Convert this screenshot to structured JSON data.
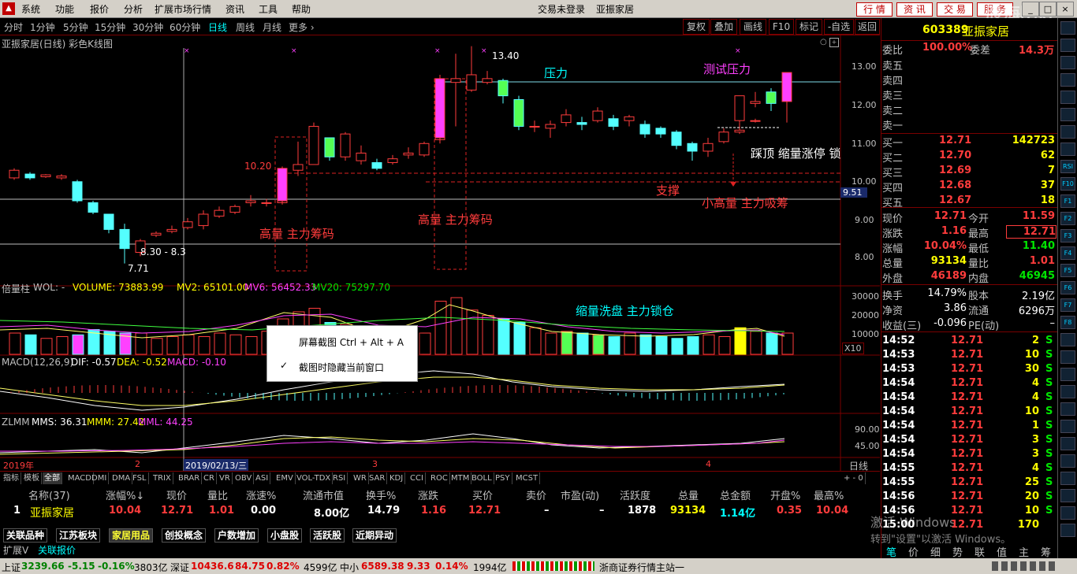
{
  "menu": {
    "items": [
      "系统",
      "功能",
      "报价",
      "分析",
      "扩展市场行情",
      "资讯",
      "工具",
      "帮助"
    ],
    "center": [
      "交易未登录",
      "亚振家居"
    ],
    "buttons": [
      "行 情",
      "资 讯",
      "交 易",
      "服 务"
    ],
    "watermark": "股海明灯"
  },
  "toolbar": {
    "periods": [
      "分时",
      "1分钟",
      "5分钟",
      "15分钟",
      "30分钟",
      "60分钟",
      "日线",
      "周线",
      "月线",
      "更多 ›"
    ],
    "active_period": "日线",
    "buttons": [
      "复权",
      "叠加",
      "画线",
      "F10",
      "标记",
      "-自选",
      "返回"
    ]
  },
  "chart": {
    "title": "亚振家居(日线) 彩色K线图",
    "price_axis": [
      "13.00",
      "12.00",
      "11.00",
      "10.00",
      "9.00",
      "8.00"
    ],
    "current_price_tag": "9.51",
    "annotations": {
      "high_label": "13.40",
      "level_1020": "10.20",
      "low_range": "8.30 - 8.3",
      "low_label": "7.71",
      "pressure": "压力",
      "test_pressure": "测试压力",
      "kick_top": "踩顶 缩量涨停 锁",
      "support": "支撑",
      "small_volume": "小高量 主力吸筹",
      "high_volume_1": "高量 主力筹码",
      "high_volume_2": "高量 主力筹码",
      "shrink_wash": "缩量洗盘 主力锁仓"
    },
    "volume_header": {
      "name": "倍量柱",
      "wol": "WOL: -",
      "volume": "VOLUME: 73883.99",
      "mv2": "MV2: 65101.00",
      "mv6": "MV6: 56452.33",
      "mv20": "MV20: 75297.70"
    },
    "volume_axis": [
      "30000",
      "20000",
      "10000"
    ],
    "volume_unit": "X10",
    "macd_header": {
      "name": "MACD(12,26,9)",
      "dif": "DIF: -0.57",
      "dea": "DEA: -0.52",
      "macd": "MACD: -0.10"
    },
    "zlmm_header": {
      "name": "ZLMM",
      "mms": "MMS: 36.31",
      "mmm": "MMM: 27.42",
      "mml": "MML: 44.25"
    },
    "zlmm_axis": [
      "90.00",
      "45.00"
    ],
    "date_axis": {
      "year": "2019年",
      "m2": "2",
      "date_tag": "2019/02/13/三",
      "m3": "3",
      "m4": "4"
    },
    "period_label": "日线"
  },
  "context_menu": {
    "items": [
      "屏幕截图 Ctrl + Alt + A",
      "截图时隐藏当前窗口"
    ],
    "checked_index": 1
  },
  "indicator_tabs": [
    "指标",
    "模板",
    "全部",
    "MACD",
    "DMI",
    "DMA",
    "FSL",
    "TRIX",
    "BRAR",
    "CR",
    "VR",
    "OBV",
    "ASI",
    "EMV",
    "VOL-TDX",
    "RSI",
    "WR",
    "SAR",
    "KDJ",
    "CCI",
    "ROC",
    "MTM",
    "BOLL",
    "PSY",
    "MCST"
  ],
  "quote_list": {
    "headers": [
      "名称(37)",
      "涨幅%↓",
      "现价",
      "量比",
      "涨速%",
      "流通市值",
      "换手%",
      "涨跌",
      "买价",
      "卖价",
      "市盈(动)",
      "活跃度",
      "总量",
      "总金额",
      "开盘%",
      "最高%"
    ],
    "row": {
      "idx": "1",
      "name": "亚振家居",
      "change_pct": "10.04",
      "price": "12.71",
      "vol_ratio": "1.01",
      "speed": "0.00",
      "float_cap": "8.00亿",
      "turnover": "14.79",
      "change": "1.16",
      "bid": "12.71",
      "ask": "–",
      "pe": "–",
      "activity": "1878",
      "volume": "93134",
      "amount": "1.14亿",
      "open_pct": "0.35",
      "high_pct": "10.04"
    }
  },
  "sector_tabs": [
    "关联品种",
    "江苏板块",
    "家居用品",
    "创投概念",
    "户数增加",
    "小盘股",
    "活跃股",
    "近期异动"
  ],
  "active_sector": "家居用品",
  "extra_tabs": [
    "扩展V",
    "关联报价"
  ],
  "right_panel": {
    "code": "603389",
    "name": "亚振家居",
    "weibi_label": "委比",
    "weibi": "100.00%",
    "weicha_label": "委差",
    "weicha": "14.3万",
    "sells": [
      "卖五",
      "卖四",
      "卖三",
      "卖二",
      "卖一"
    ],
    "buys": [
      {
        "label": "买一",
        "price": "12.71",
        "vol": "142723"
      },
      {
        "label": "买二",
        "price": "12.70",
        "vol": "62"
      },
      {
        "label": "买三",
        "price": "12.69",
        "vol": "7"
      },
      {
        "label": "买四",
        "price": "12.68",
        "vol": "37"
      },
      {
        "label": "买五",
        "price": "12.67",
        "vol": "18"
      }
    ],
    "stats": [
      {
        "l1": "现价",
        "v1": "12.71",
        "l2": "今开",
        "v2": "11.59"
      },
      {
        "l1": "涨跌",
        "v1": "1.16",
        "l2": "最高",
        "v2": "12.71"
      },
      {
        "l1": "涨幅",
        "v1": "10.04%",
        "l2": "最低",
        "v2": "11.40"
      },
      {
        "l1": "总量",
        "v1": "93134",
        "l2": "量比",
        "v2": "1.01"
      },
      {
        "l1": "外盘",
        "v1": "46189",
        "l2": "内盘",
        "v2": "46945"
      }
    ],
    "stats2": [
      {
        "l1": "换手",
        "v1": "14.79%",
        "l2": "股本",
        "v2": "2.19亿"
      },
      {
        "l1": "净资",
        "v1": "3.86",
        "l2": "流通",
        "v2": "6296万"
      },
      {
        "l1": "收益(三)",
        "v1": "-0.096",
        "l2": "PE(动)",
        "v2": "–"
      }
    ],
    "ticks": [
      {
        "t": "14:52",
        "p": "12.71",
        "v": "2",
        "s": "S"
      },
      {
        "t": "14:53",
        "p": "12.71",
        "v": "10",
        "s": "S"
      },
      {
        "t": "14:53",
        "p": "12.71",
        "v": "30",
        "s": "S"
      },
      {
        "t": "14:54",
        "p": "12.71",
        "v": "4",
        "s": "S"
      },
      {
        "t": "14:54",
        "p": "12.71",
        "v": "4",
        "s": "S"
      },
      {
        "t": "14:54",
        "p": "12.71",
        "v": "10",
        "s": "S"
      },
      {
        "t": "14:54",
        "p": "12.71",
        "v": "1",
        "s": "S"
      },
      {
        "t": "14:54",
        "p": "12.71",
        "v": "3",
        "s": "S"
      },
      {
        "t": "14:54",
        "p": "12.71",
        "v": "3",
        "s": "S"
      },
      {
        "t": "14:55",
        "p": "12.71",
        "v": "4",
        "s": "S"
      },
      {
        "t": "14:55",
        "p": "12.71",
        "v": "25",
        "s": "S"
      },
      {
        "t": "14:56",
        "p": "12.71",
        "v": "20",
        "s": "S"
      },
      {
        "t": "14:56",
        "p": "12.71",
        "v": "10",
        "s": "S"
      },
      {
        "t": "15:00",
        "p": "12.71",
        "v": "170",
        "s": ""
      }
    ],
    "activation": [
      "激活 Windows",
      "转到\"设置\"以激活 Windows。"
    ],
    "bottom_tabs": [
      "笔",
      "价",
      "细",
      "势",
      "联",
      "值",
      "主",
      "筹"
    ]
  },
  "sidebar_icons": [
    "RSI",
    "F10",
    "F1",
    "F2",
    "F3",
    "F4",
    "F5",
    "F6",
    "F7",
    "F8"
  ],
  "status": {
    "sh_label": "上证",
    "sh_val": "3239.66",
    "sh_chg": "-5.15",
    "sh_pct": "-0.16%",
    "sh_amt": "3803亿",
    "sz_label": "深证",
    "sz_val": "10436.6",
    "sz_chg": "84.75",
    "sz_pct": "0.82%",
    "sz_amt": "4599亿",
    "zx_label": "中小",
    "zx_val": "6589.38",
    "zx_chg": "9.33",
    "zx_pct": "0.14%",
    "zx_amt": "1994亿",
    "station": "浙商证券行情主站一"
  }
}
